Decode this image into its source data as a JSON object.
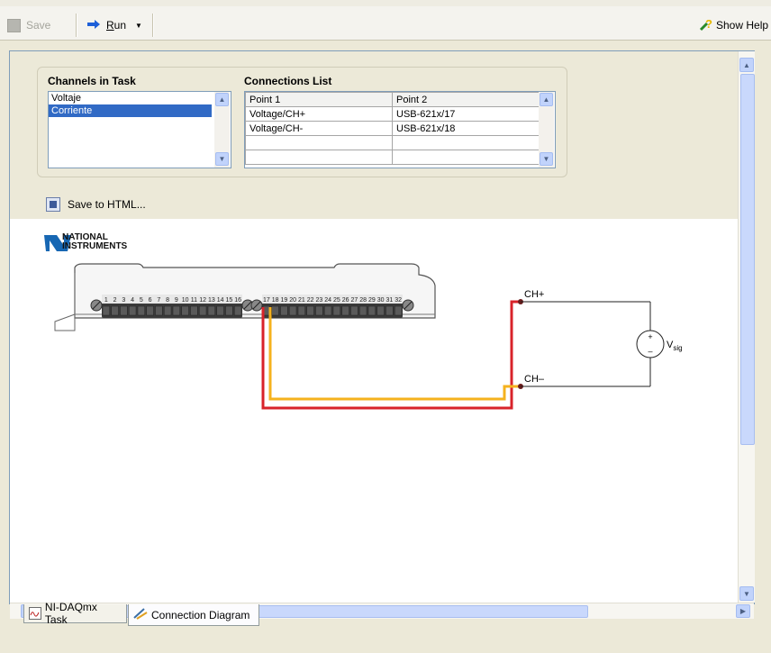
{
  "toolbar": {
    "save_label": "Save",
    "run_label": "Run",
    "run_mnemonic": "R",
    "run_rest": "un",
    "show_help_label": "Show Help"
  },
  "channels": {
    "title": "Channels in Task",
    "items": [
      "Voltaje",
      "Corriente"
    ],
    "selected_index": 1
  },
  "connections": {
    "title": "Connections List",
    "columns": [
      "Point 1",
      "Point 2"
    ],
    "rows": [
      [
        "Voltage/CH+",
        "USB-621x/17"
      ],
      [
        "Voltage/CH-",
        "USB-621x/18"
      ],
      [
        "",
        ""
      ],
      [
        "",
        ""
      ]
    ]
  },
  "save_html_label": "Save to HTML...",
  "diagram": {
    "brand_line1": "NATIONAL",
    "brand_line2": "INSTRUMENTS",
    "terminals_left": [
      "1",
      "2",
      "3",
      "4",
      "5",
      "6",
      "7",
      "8",
      "9",
      "10",
      "11",
      "12",
      "13",
      "14",
      "15",
      "16"
    ],
    "terminals_right": [
      "17",
      "18",
      "19",
      "20",
      "21",
      "22",
      "23",
      "24",
      "25",
      "26",
      "27",
      "28",
      "29",
      "30",
      "31",
      "32"
    ],
    "ch_plus": "CH+",
    "ch_minus": "CH–",
    "vsig_main": "V",
    "vsig_sub": "sig",
    "plus_sign": "+",
    "minus_sign": "–",
    "wire_colors": {
      "red": "#d8232a",
      "yellow": "#f5b21e"
    }
  },
  "tabs": [
    {
      "label": "NI-DAQmx Task",
      "active": false
    },
    {
      "label": "Connection Diagram",
      "active": true
    }
  ]
}
